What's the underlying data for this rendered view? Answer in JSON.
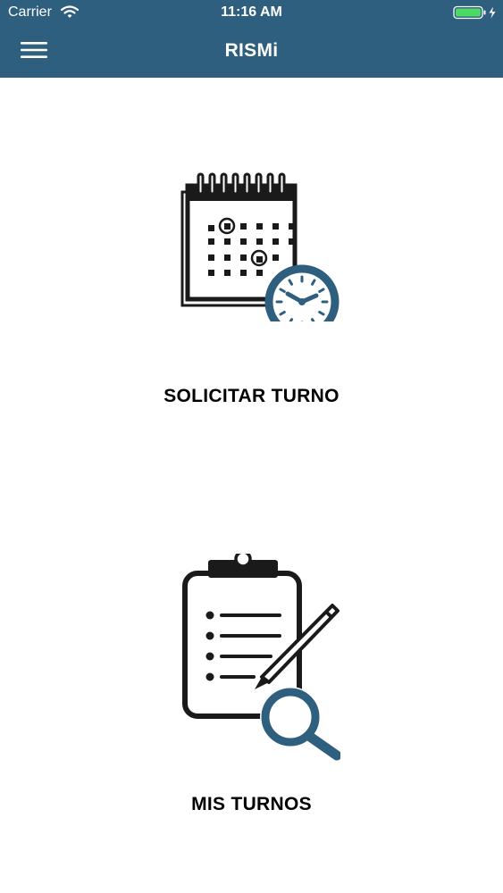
{
  "status_bar": {
    "carrier": "Carrier",
    "time": "11:16 AM",
    "icons": [
      "wifi-icon",
      "battery-charging-icon"
    ],
    "battery_color": "#4cd964"
  },
  "header": {
    "title": "RISMi",
    "menu_icon": "hamburger-menu-icon",
    "background_color": "#2e5f7e"
  },
  "menu": {
    "items": [
      {
        "label": "SOLICITAR TURNO",
        "icon": "calendar-clock-icon"
      },
      {
        "label": "MIS TURNOS",
        "icon": "clipboard-search-icon"
      }
    ]
  },
  "colors": {
    "accent": "#2e5f7e",
    "text": "#000000",
    "icon_dark": "#1a1a1a"
  }
}
